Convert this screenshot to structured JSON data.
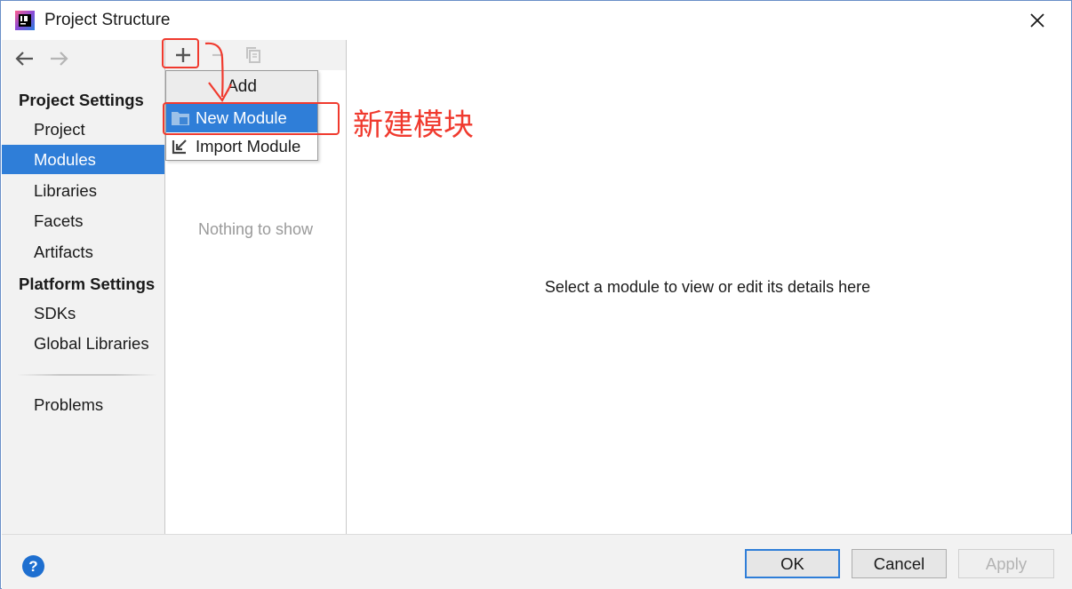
{
  "window": {
    "title": "Project Structure"
  },
  "sidebar": {
    "sections": [
      {
        "header": "Project Settings",
        "items": [
          "Project",
          "Modules",
          "Libraries",
          "Facets",
          "Artifacts"
        ]
      },
      {
        "header": "Platform Settings",
        "items": [
          "SDKs",
          "Global Libraries"
        ]
      }
    ],
    "problems_label": "Problems",
    "selected_item": "Modules"
  },
  "middle": {
    "empty_text": "Nothing to show"
  },
  "popup": {
    "header": "Add",
    "items": [
      "New Module",
      "Import Module"
    ],
    "selected_item": "New Module"
  },
  "detail": {
    "hint": "Select a module to view or edit its details here"
  },
  "footer": {
    "help_label": "?",
    "ok_label": "OK",
    "cancel_label": "Cancel",
    "apply_label": "Apply"
  },
  "annotation": {
    "text": "新建模块",
    "color": "#f03a2e"
  },
  "colors": {
    "selection": "#2f7ed8",
    "sidebar_bg": "#f2f2f2",
    "annotation": "#f03a2e"
  }
}
